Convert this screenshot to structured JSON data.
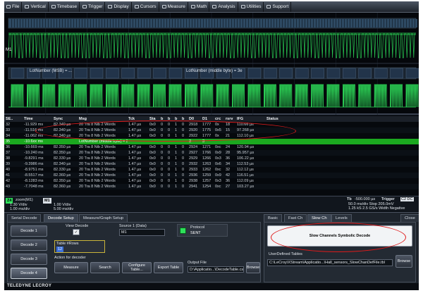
{
  "menu": [
    {
      "label": "File",
      "icon": "file-icon"
    },
    {
      "label": "Vertical",
      "icon": "vertical-icon"
    },
    {
      "label": "Timebase",
      "icon": "timebase-icon"
    },
    {
      "label": "Trigger",
      "icon": "trigger-icon"
    },
    {
      "label": "Display",
      "icon": "display-icon"
    },
    {
      "label": "Cursors",
      "icon": "cursors-icon"
    },
    {
      "label": "Measure",
      "icon": "measure-icon"
    },
    {
      "label": "Math",
      "icon": "math-icon"
    },
    {
      "label": "Analysis",
      "icon": "analysis-icon"
    },
    {
      "label": "Utilities",
      "icon": "utilities-icon"
    },
    {
      "label": "Support",
      "icon": "support-icon"
    }
  ],
  "waveform": {
    "trace1_label": "M1",
    "zoom_label": "LotNumber (middle byte) = 3e",
    "zoom_label_left": "LotNumber (MSB) = ...",
    "trace_color": "#2ee05a"
  },
  "table": {
    "headers": [
      "SE..",
      "Time",
      "Sync",
      "Msg",
      "Tck",
      "Sta",
      "b",
      "b",
      "b",
      "b",
      "D0",
      "D1",
      "crc",
      "rsrv",
      "IFG",
      "Status"
    ],
    "rows": [
      [
        "32",
        "-11.929 ms",
        "82.340 µs",
        "20 Tra  8 Nib 2 Words",
        "1.47 µs",
        "0x0",
        "0",
        "0",
        "1",
        "0",
        "2918",
        "1777",
        "0x",
        "18",
        "110.66 µs",
        ""
      ],
      [
        "33",
        "-11.516 ms",
        "82.340 µs",
        "20 Tra  8 Nib 2 Words",
        "1.47 µs",
        "0x0",
        "0",
        "0",
        "1",
        "0",
        "2920",
        "1775",
        "0x5",
        "15",
        "97.268 µs",
        ""
      ],
      [
        "34",
        "-11.062 ms",
        "82.340 µs",
        "20 Tra  8 Nib 2 Words",
        "1.47 µs",
        "0x0",
        "0",
        "0",
        "1",
        "0",
        "2922",
        "1777",
        "0x",
        "21",
        "112.10 µs",
        ""
      ],
      [
        "35",
        "-10.6xx ms",
        "",
        "LotNumber (middle byte) = 3",
        "",
        "",
        "",
        "",
        "",
        "",
        "3",
        "3",
        "",
        "",
        "",
        ""
      ],
      [
        "36",
        "-10.669 ms",
        "82.350 µs",
        "20 Tra  8 Nib 2 Words",
        "1.47 µs",
        "0x0",
        "0",
        "0",
        "1",
        "0",
        "2924",
        "1271",
        "0xc",
        "24",
        "120.94 µs",
        ""
      ],
      [
        "37",
        "-10.240 ms",
        "82.350 µs",
        "20 Tra  8 Nib 2 Words",
        "1.47 µs",
        "0x0",
        "0",
        "0",
        "1",
        "0",
        "2927",
        "1766",
        "0x9",
        "28",
        "95.957 µs",
        ""
      ],
      [
        "38",
        "-9.8291 ms",
        "82.330 µs",
        "20 Tra  8 Nib 2 Words",
        "1.47 µs",
        "0x0",
        "0",
        "0",
        "1",
        "0",
        "2929",
        "1266",
        "0x3",
        "36",
        "106.22 µs",
        ""
      ],
      [
        "39",
        "-9.3986 ms",
        "82.340 µs",
        "20 Tra  8 Nib 2 Words",
        "1.47 µs",
        "0x0",
        "0",
        "0",
        "1",
        "0",
        "2932",
        "1263",
        "0x6",
        "34",
        "112.53 µs",
        ""
      ],
      [
        "40",
        "-8.9751 ms",
        "82.330 µs",
        "20 Tra  8 Nib 2 Words",
        "1.47 µs",
        "0x0",
        "0",
        "0",
        "1",
        "0",
        "2933",
        "1262",
        "0xc",
        "32",
        "112.12 µs",
        ""
      ],
      [
        "41",
        "-8.5517 ms",
        "82.360 µs",
        "20 Tra  8 Nib 2 Words",
        "1.47 µs",
        "0x0",
        "0",
        "0",
        "1",
        "0",
        "2936",
        "1259",
        "0x9",
        "42",
        "116.51 µs",
        ""
      ],
      [
        "42",
        "-8.1283 ms",
        "82.350 µs",
        "20 Tra  8 Nib 2 Words",
        "1.47 µs",
        "0x0",
        "0",
        "0",
        "1",
        "0",
        "2938",
        "1257",
        "0x3",
        "36",
        "112.09 µs",
        ""
      ],
      [
        "43",
        "-7.7048 ms",
        "82.360 µs",
        "20 Tra  8 Nib 2 Words",
        "1.47 µs",
        "0x0",
        "0",
        "0",
        "1",
        "0",
        "2941",
        "1254",
        "0xc",
        "27",
        "103.27 µs",
        ""
      ]
    ],
    "highlight_row_index": 3
  },
  "status": {
    "ch_badge": "Z4",
    "ch_name": "zoom(M1)",
    "ch_line2": "1.30 V/div",
    "ch_line3": "1.00 ms/div",
    "m1_badge": "M1",
    "m1_line2": "1.00 V/div",
    "m1_line3": "5.00 ms/div",
    "tb_label": "Tb",
    "tb_value": "-500.000 µs",
    "trigger_label": "Trigger",
    "trigger_mode": "C2 DC",
    "sample_line1": "50.0 ms/div  Stop  205.0mV",
    "sample_line2": "1.25 kS    2.5 GS/s  Width  Negative"
  },
  "dialog": {
    "tabs": [
      "Serial Decode",
      "Decode Setup",
      "Measure/Graph Setup"
    ],
    "active_tab_index": 1,
    "decode_buttons": [
      "Decode 1",
      "Decode 2",
      "Decode 3",
      "Decode 4"
    ],
    "active_decode_index": 3,
    "view_decode_label": "View Decode",
    "view_decode_checked": "✓",
    "source_label": "Source 1 (Data)",
    "source_value": "M1",
    "protocol_label": "Protocol",
    "protocol_value": "SENT",
    "table_rows_label": "Table #Rows",
    "table_rows_value": "12",
    "action_label": "Action for decoder",
    "btn_measure": "Measure",
    "btn_search": "Search",
    "btn_configure": "Configure Table...",
    "btn_export": "Export Table",
    "output_label": "Output File",
    "output_value": "D:\\Applicatio...\\DecodeTable.csv",
    "btn_browse": "Browse",
    "right_tabs": [
      "Basic",
      "Fast Ch",
      "Slow Ch",
      "Levels"
    ],
    "right_active_index": 2,
    "close_label": "Close",
    "slow_channel_btn": "Slow Channels Symbolic Decode",
    "user_tables_label": "UserDefined Tables",
    "user_tables_value": "C:\\LeCroy\\XStream\\Applicatio...\\Hall_sensors_SlowChanDefFile.tbl",
    "btn_browse2": "Browse"
  },
  "footer": {
    "logo": "TELEDYNE LECROY"
  }
}
